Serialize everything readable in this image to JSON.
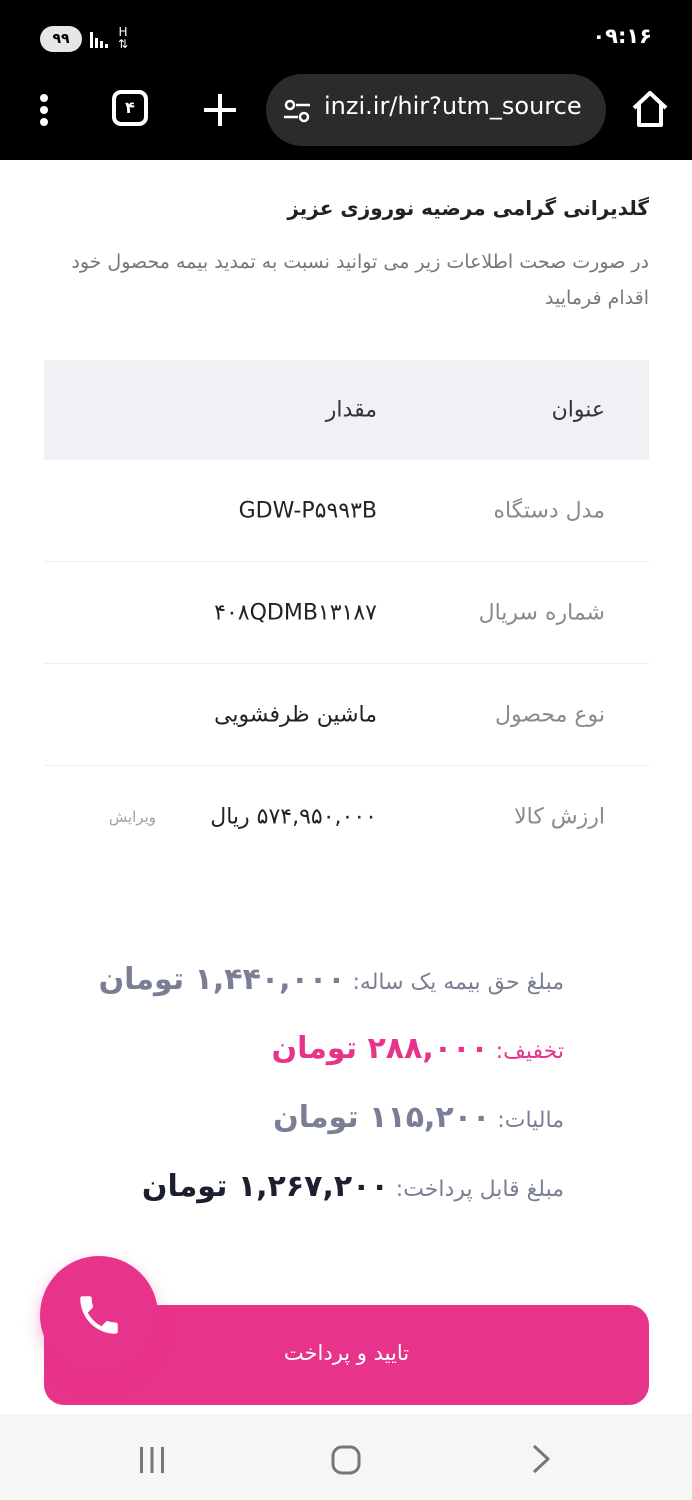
{
  "status_bar": {
    "time": "۰۹:۱۶",
    "battery": "۹۹"
  },
  "browser": {
    "tab_count": "۴",
    "url": "inzi.ir/hir?utm_source"
  },
  "greeting": {
    "title": "گلدیرانی گرامی مرضیه نوروزی عزیز",
    "description": "در صورت صحت اطلاعات زیر می توانید نسبت به تمدید بیمه محصول خود اقدام فرمایید"
  },
  "table": {
    "headers": {
      "title": "عنوان",
      "value": "مقدار"
    },
    "rows": [
      {
        "title": "مدل دستگاه",
        "value": "GDW-P۵۹۹۳B"
      },
      {
        "title": "شماره سریال",
        "value": "۴۰۸QDMB۱۳۱۸۷"
      },
      {
        "title": "نوع محصول",
        "value": "ماشین ظرفشویی"
      },
      {
        "title": "ارزش کالا",
        "value": "۵۷۴,۹۵۰,۰۰۰ ریال",
        "edit": "ویرایش"
      }
    ]
  },
  "summary": {
    "premium": {
      "label": "مبلغ حق بیمه یک ساله:",
      "value": "۱,۴۴۰,۰۰۰ تومان"
    },
    "discount": {
      "label": "تخفیف:",
      "value": "۲۸۸,۰۰۰ تومان"
    },
    "tax": {
      "label": "مالیات:",
      "value": "۱۱۵,۲۰۰ تومان"
    },
    "payable": {
      "label": "مبلغ قابل پرداخت:",
      "value": "۱,۲۶۷,۲۰۰ تومان"
    }
  },
  "actions": {
    "pay_label": "تایید و پرداخت"
  },
  "colors": {
    "accent": "#e8338a",
    "muted_amount": "#7b7f95",
    "payable": "#1c1f2e"
  }
}
